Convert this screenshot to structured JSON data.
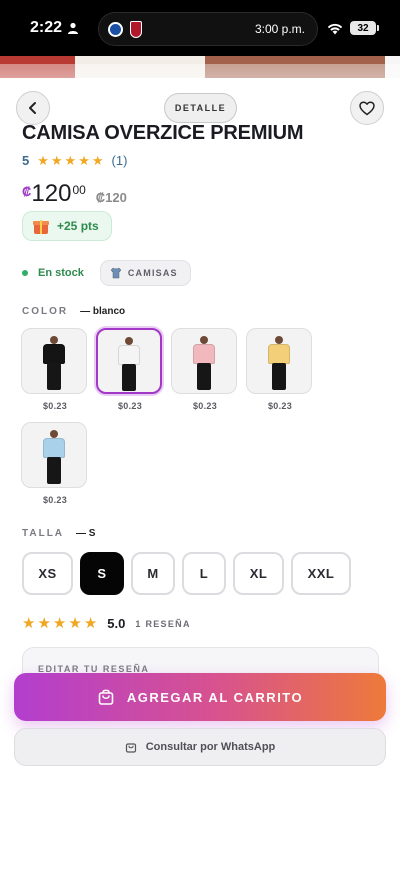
{
  "status_bar": {
    "time": "2:22",
    "island_time": "3:00 p.m.",
    "battery": "32"
  },
  "header": {
    "detail_label": "DETALLE"
  },
  "product": {
    "title": "CAMISA OVERZICE PREMIUM",
    "rating": "5",
    "star_count": 5,
    "review_count": "(1)",
    "currency_symbol": "₡",
    "price_int": "120",
    "price_dec": "00",
    "old_price": "₡120",
    "points": "+25 pts",
    "stock_text": "En stock",
    "category": "CAMISAS"
  },
  "color_section": {
    "label": "COLOR",
    "selected": "— blanco",
    "swatches": [
      {
        "price": "$0.23",
        "shirt_color": "#141414"
      },
      {
        "price": "$0.23",
        "shirt_color": "#f4f4f4",
        "selected": true
      },
      {
        "price": "$0.23",
        "shirt_color": "#f1b8bd"
      },
      {
        "price": "$0.23",
        "shirt_color": "#f3cf7a"
      },
      {
        "price": "$0.23",
        "shirt_color": "#a9d2ea"
      }
    ]
  },
  "size_section": {
    "label": "TALLA",
    "selected": "— S",
    "sizes": [
      "XS",
      "S",
      "M",
      "L",
      "XL",
      "XXL"
    ],
    "active_size": "S"
  },
  "reviews": {
    "score": "5.0",
    "label": "1 RESEÑA",
    "edit_label": "EDITAR TU RESEÑA"
  },
  "actions": {
    "cart_label": "AGREGAR AL CARRITO",
    "whatsapp_label": "Consultar por WhatsApp"
  },
  "colors": {
    "accent_purple": "#a238c8",
    "gradient_start": "#b23ecf",
    "gradient_end": "#ee7a3a",
    "stock_green": "#2fae6a",
    "star_gold": "#f0a722"
  }
}
